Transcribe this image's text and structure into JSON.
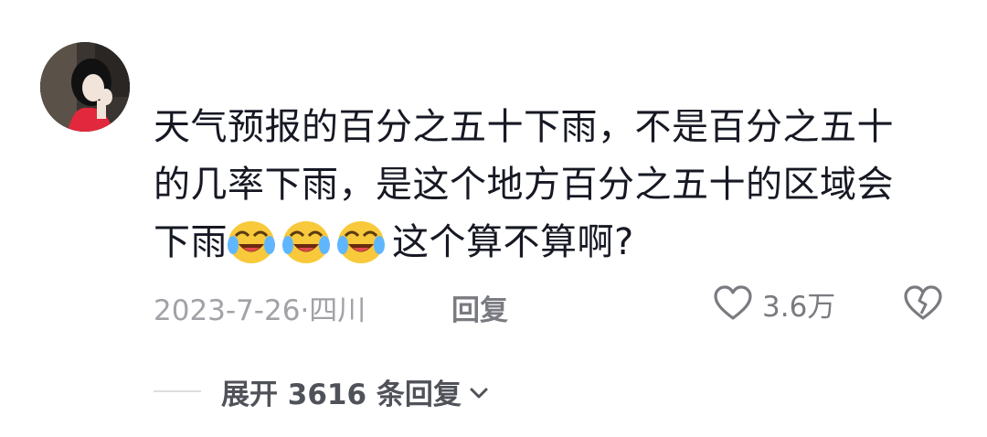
{
  "comment": {
    "lines": [
      "天气预报的百分之五十下雨，不是百分之五十",
      "的几率下雨，是这个地方百分之五十的区域会",
      "下雨"
    ],
    "emoji_name": "laugh-cry-emoji",
    "emoji_count": 3,
    "tail_text": "这个算不算啊?",
    "date": "2023-7-26",
    "separator": "·",
    "location": "四川",
    "reply_label": "回复",
    "like_count": "3.6万"
  },
  "replies": {
    "expand_label": "展开 3616 条回复"
  },
  "icons": {
    "like": "heart-outline-icon",
    "dislike": "broken-heart-icon",
    "expand": "chevron-down-icon"
  },
  "colors": {
    "primary_text": "#161823",
    "meta_text": "#a1a2a7",
    "action_text": "#7a7b80",
    "expand_text": "#505259",
    "emoji_face": "#f8c93a"
  }
}
